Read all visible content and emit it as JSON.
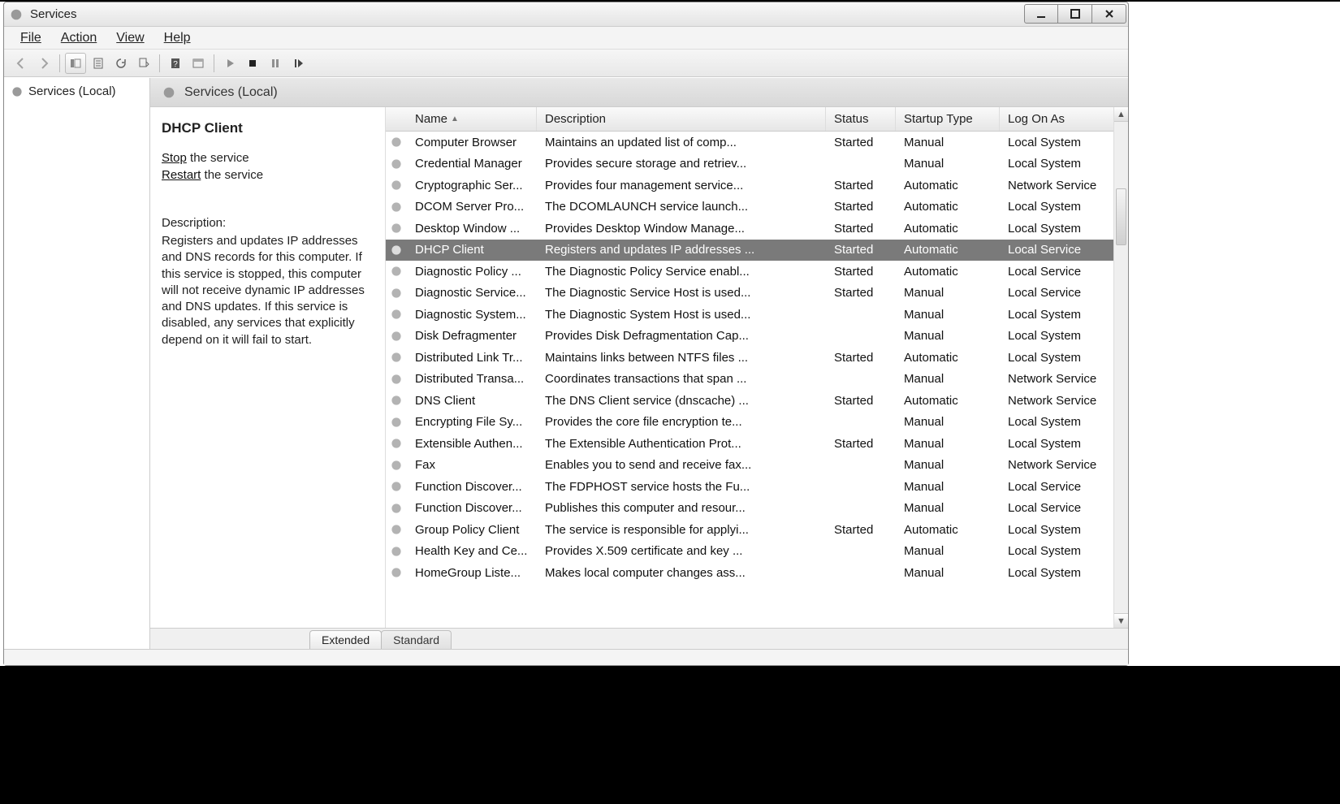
{
  "window": {
    "title": "Services"
  },
  "menus": {
    "file": "File",
    "action": "Action",
    "view": "View",
    "help": "Help"
  },
  "tree": {
    "root": "Services (Local)"
  },
  "pane": {
    "header": "Services (Local)"
  },
  "detail": {
    "title": "DHCP Client",
    "stop_word": "Stop",
    "stop_rest": " the service",
    "restart_word": "Restart",
    "restart_rest": " the service",
    "desc_label": "Description:",
    "desc_body": "Registers and updates IP addresses and DNS records for this computer. If this service is stopped, this computer will not receive dynamic IP addresses and DNS updates. If this service is disabled, any services that explicitly depend on it will fail to start."
  },
  "columns": {
    "name": "Name",
    "description": "Description",
    "status": "Status",
    "startup": "Startup Type",
    "logon": "Log On As"
  },
  "tabs": {
    "extended": "Extended",
    "standard": "Standard"
  },
  "selected_index": 5,
  "rows": [
    {
      "name": "Computer Browser",
      "desc": "Maintains an updated list of comp...",
      "status": "Started",
      "startup": "Manual",
      "logon": "Local System"
    },
    {
      "name": "Credential Manager",
      "desc": "Provides secure storage and retriev...",
      "status": "",
      "startup": "Manual",
      "logon": "Local System"
    },
    {
      "name": "Cryptographic Ser...",
      "desc": "Provides four management service...",
      "status": "Started",
      "startup": "Automatic",
      "logon": "Network Service"
    },
    {
      "name": "DCOM Server Pro...",
      "desc": "The DCOMLAUNCH service launch...",
      "status": "Started",
      "startup": "Automatic",
      "logon": "Local System"
    },
    {
      "name": "Desktop Window ...",
      "desc": "Provides Desktop Window Manage...",
      "status": "Started",
      "startup": "Automatic",
      "logon": "Local System"
    },
    {
      "name": "DHCP Client",
      "desc": "Registers and updates IP addresses ...",
      "status": "Started",
      "startup": "Automatic",
      "logon": "Local Service"
    },
    {
      "name": "Diagnostic Policy ...",
      "desc": "The Diagnostic Policy Service enabl...",
      "status": "Started",
      "startup": "Automatic",
      "logon": "Local Service"
    },
    {
      "name": "Diagnostic Service...",
      "desc": "The Diagnostic Service Host is used...",
      "status": "Started",
      "startup": "Manual",
      "logon": "Local Service"
    },
    {
      "name": "Diagnostic System...",
      "desc": "The Diagnostic System Host is used...",
      "status": "",
      "startup": "Manual",
      "logon": "Local System"
    },
    {
      "name": "Disk Defragmenter",
      "desc": "Provides Disk Defragmentation Cap...",
      "status": "",
      "startup": "Manual",
      "logon": "Local System"
    },
    {
      "name": "Distributed Link Tr...",
      "desc": "Maintains links between NTFS files ...",
      "status": "Started",
      "startup": "Automatic",
      "logon": "Local System"
    },
    {
      "name": "Distributed Transa...",
      "desc": "Coordinates transactions that span ...",
      "status": "",
      "startup": "Manual",
      "logon": "Network Service"
    },
    {
      "name": "DNS Client",
      "desc": "The DNS Client service (dnscache) ...",
      "status": "Started",
      "startup": "Automatic",
      "logon": "Network Service"
    },
    {
      "name": "Encrypting File Sy...",
      "desc": "Provides the core file encryption te...",
      "status": "",
      "startup": "Manual",
      "logon": "Local System"
    },
    {
      "name": "Extensible Authen...",
      "desc": "The Extensible Authentication Prot...",
      "status": "Started",
      "startup": "Manual",
      "logon": "Local System"
    },
    {
      "name": "Fax",
      "desc": "Enables you to send and receive fax...",
      "status": "",
      "startup": "Manual",
      "logon": "Network Service"
    },
    {
      "name": "Function Discover...",
      "desc": "The FDPHOST service hosts the Fu...",
      "status": "",
      "startup": "Manual",
      "logon": "Local Service"
    },
    {
      "name": "Function Discover...",
      "desc": "Publishes this computer and resour...",
      "status": "",
      "startup": "Manual",
      "logon": "Local Service"
    },
    {
      "name": "Group Policy Client",
      "desc": "The service is responsible for applyi...",
      "status": "Started",
      "startup": "Automatic",
      "logon": "Local System"
    },
    {
      "name": "Health Key and Ce...",
      "desc": "Provides X.509 certificate and key ...",
      "status": "",
      "startup": "Manual",
      "logon": "Local System"
    },
    {
      "name": "HomeGroup Liste...",
      "desc": "Makes local computer changes ass...",
      "status": "",
      "startup": "Manual",
      "logon": "Local System"
    }
  ]
}
